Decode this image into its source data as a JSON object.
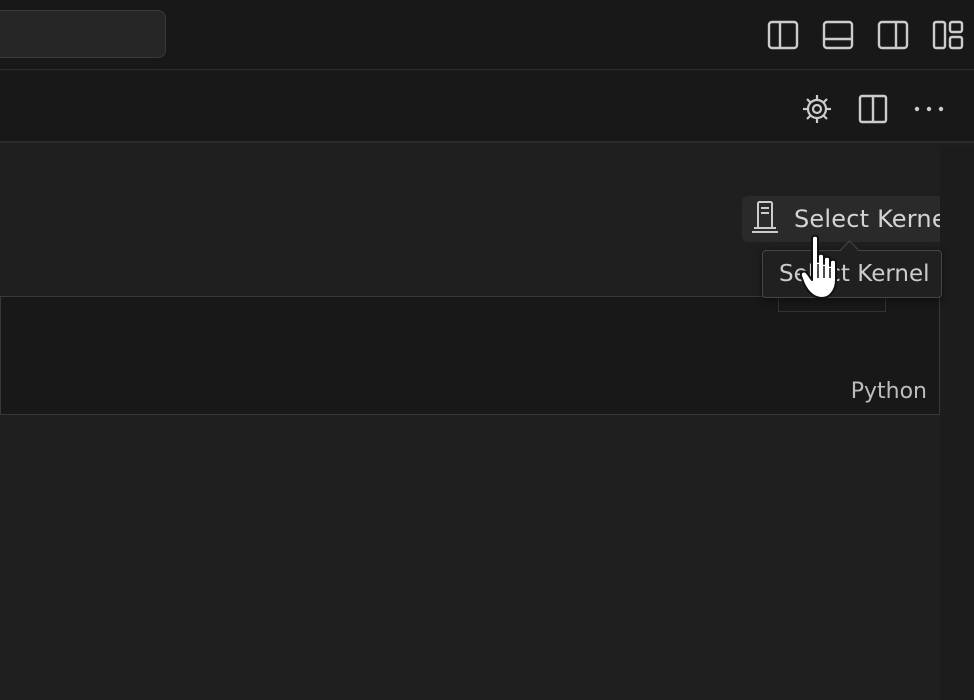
{
  "titlebar": {
    "icons": [
      "toggle-primary-sidebar-icon",
      "toggle-panel-icon",
      "toggle-secondary-sidebar-icon",
      "customize-layout-icon"
    ]
  },
  "editor_toolbar": {
    "icons": [
      "settings-gear-icon",
      "split-editor-icon",
      "more-actions-icon"
    ]
  },
  "notebook": {
    "kernel_button_label": "Select Kernel",
    "kernel_tooltip": "Select Kernel",
    "cell_language": "Python"
  },
  "colors": {
    "background": "#1f1f1f",
    "titlebar": "#181818",
    "button_bg": "#2a2a2a",
    "text": "#d4d4d4"
  }
}
